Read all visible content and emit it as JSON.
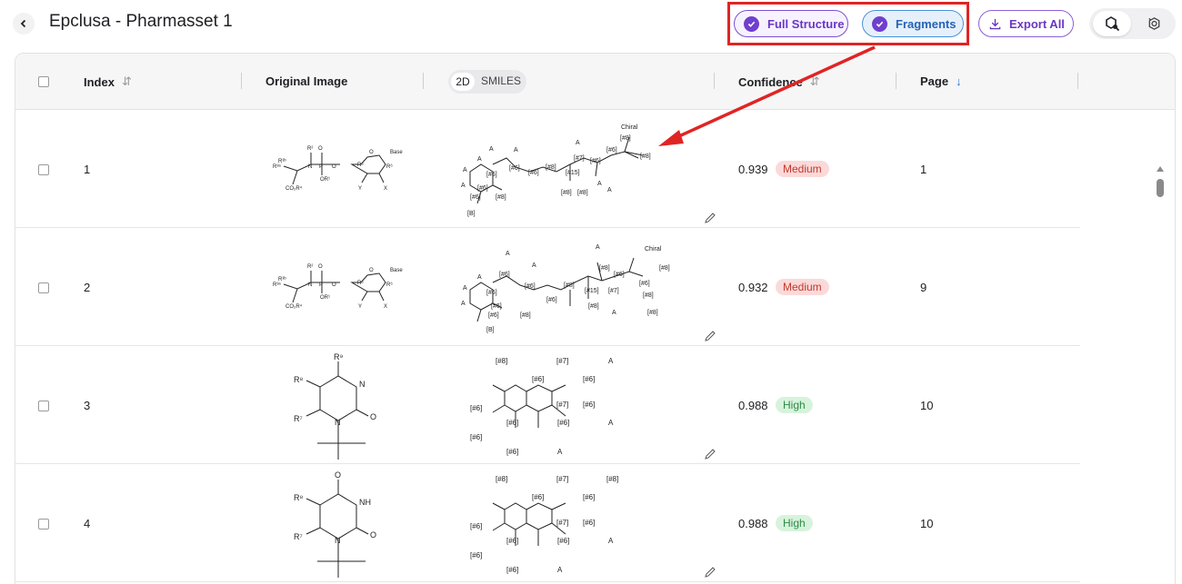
{
  "header": {
    "title": "Epclusa - Pharmasset 1",
    "full_structure_label": "Full Structure",
    "fragments_label": "Fragments",
    "export_label": "Export All"
  },
  "table": {
    "columns": {
      "index": "Index",
      "original_image": "Original Image",
      "view_2d": "2D",
      "view_smiles": "SMILES",
      "confidence": "Confidence",
      "page": "Page"
    },
    "rows": [
      {
        "index": "1",
        "confidence": "0.939",
        "level": "Medium",
        "page": "1"
      },
      {
        "index": "2",
        "confidence": "0.932",
        "level": "Medium",
        "page": "9"
      },
      {
        "index": "3",
        "confidence": "0.988",
        "level": "High",
        "page": "10"
      },
      {
        "index": "4",
        "confidence": "0.988",
        "level": "High",
        "page": "10"
      }
    ]
  },
  "icons": {
    "back": "chevron-left-icon",
    "check": "check-circle-icon",
    "export": "download-icon",
    "sort": "sort-icon",
    "edit": "pencil-icon"
  },
  "colors": {
    "accent_purple": "#6a37c4",
    "accent_blue": "#2563b5",
    "annotation_red": "#e02424",
    "medium_bg": "#fbd9d9",
    "high_bg": "#d7f3dc"
  }
}
